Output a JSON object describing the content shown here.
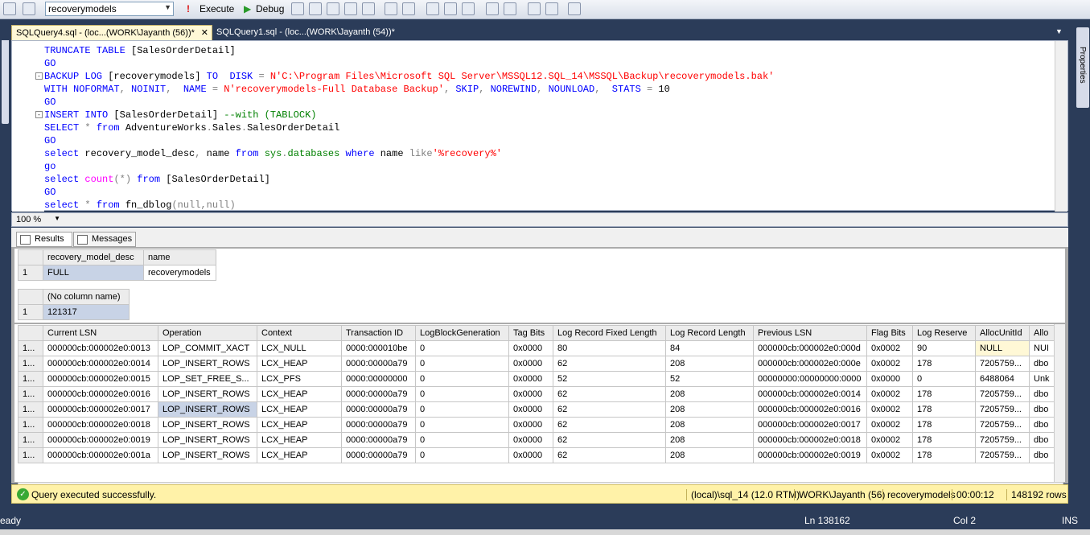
{
  "toolbar": {
    "database": "recoverymodels",
    "execute_label": "Execute",
    "debug_label": "Debug"
  },
  "tabs": [
    {
      "label": "SQLQuery4.sql - (loc...(WORK\\Jayanth (56))*",
      "close": "✕"
    },
    {
      "label": "SQLQuery1.sql - (loc...(WORK\\Jayanth (54))*"
    }
  ],
  "properties_label": "Properties",
  "editor": {
    "zoom": "100 %"
  },
  "results_tabs": {
    "results": "Results",
    "messages": "Messages"
  },
  "grid1": {
    "headers": [
      "recovery_model_desc",
      "name"
    ],
    "rows": [
      [
        "1",
        "FULL",
        "recoverymodels"
      ]
    ]
  },
  "grid2": {
    "headers": [
      "(No column name)"
    ],
    "rows": [
      [
        "1",
        "121317"
      ]
    ]
  },
  "grid3": {
    "headers": [
      "Current LSN",
      "Operation",
      "Context",
      "Transaction ID",
      "LogBlockGeneration",
      "Tag Bits",
      "Log Record Fixed Length",
      "Log Record Length",
      "Previous LSN",
      "Flag Bits",
      "Log Reserve",
      "AllocUnitId",
      "Allo"
    ],
    "rows": [
      [
        "1...",
        "000000cb:000002e0:0013",
        "LOP_COMMIT_XACT",
        "LCX_NULL",
        "0000:000010be",
        "0",
        "0x0000",
        "80",
        "84",
        "000000cb:000002e0:000d",
        "0x0002",
        "90",
        "NULL",
        "NUI"
      ],
      [
        "1...",
        "000000cb:000002e0:0014",
        "LOP_INSERT_ROWS",
        "LCX_HEAP",
        "0000:00000a79",
        "0",
        "0x0000",
        "62",
        "208",
        "000000cb:000002e0:000e",
        "0x0002",
        "178",
        "7205759...",
        "dbo"
      ],
      [
        "1...",
        "000000cb:000002e0:0015",
        "LOP_SET_FREE_S...",
        "LCX_PFS",
        "0000:00000000",
        "0",
        "0x0000",
        "52",
        "52",
        "00000000:00000000:0000",
        "0x0000",
        "0",
        "6488064",
        "Unk"
      ],
      [
        "1...",
        "000000cb:000002e0:0016",
        "LOP_INSERT_ROWS",
        "LCX_HEAP",
        "0000:00000a79",
        "0",
        "0x0000",
        "62",
        "208",
        "000000cb:000002e0:0014",
        "0x0002",
        "178",
        "7205759...",
        "dbo"
      ],
      [
        "1...",
        "000000cb:000002e0:0017",
        "LOP_INSERT_ROWS",
        "LCX_HEAP",
        "0000:00000a79",
        "0",
        "0x0000",
        "62",
        "208",
        "000000cb:000002e0:0016",
        "0x0002",
        "178",
        "7205759...",
        "dbo"
      ],
      [
        "1...",
        "000000cb:000002e0:0018",
        "LOP_INSERT_ROWS",
        "LCX_HEAP",
        "0000:00000a79",
        "0",
        "0x0000",
        "62",
        "208",
        "000000cb:000002e0:0017",
        "0x0002",
        "178",
        "7205759...",
        "dbo"
      ],
      [
        "1...",
        "000000cb:000002e0:0019",
        "LOP_INSERT_ROWS",
        "LCX_HEAP",
        "0000:00000a79",
        "0",
        "0x0000",
        "62",
        "208",
        "000000cb:000002e0:0018",
        "0x0002",
        "178",
        "7205759...",
        "dbo"
      ],
      [
        "1...",
        "000000cb:000002e0:001a",
        "LOP_INSERT_ROWS",
        "LCX_HEAP",
        "0000:00000a79",
        "0",
        "0x0000",
        "62",
        "208",
        "000000cb:000002e0:0019",
        "0x0002",
        "178",
        "7205759...",
        "dbo"
      ]
    ]
  },
  "status": {
    "message": "Query executed successfully.",
    "server": "(local)\\sql_14 (12.0 RTM)",
    "user": "WORK\\Jayanth (56)",
    "database": "recoverymodels",
    "elapsed": "00:00:12",
    "rows": "148192 rows"
  },
  "bottom": {
    "ready": "eady",
    "ln": "Ln 138162",
    "col": "Col 2",
    "ins": "INS"
  },
  "colors": {
    "chrome": "#2b3c59",
    "status_bg": "#fff2a8",
    "keyword": "#0000ff",
    "string": "#ff0000",
    "function": "#ff00ff"
  }
}
